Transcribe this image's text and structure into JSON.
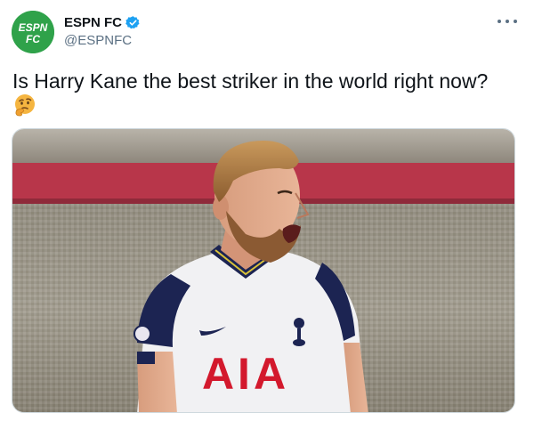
{
  "account": {
    "display_name": "ESPN FC",
    "handle": "@ESPNFC",
    "avatar_text_top": "ESPN",
    "avatar_text_bottom": "FC",
    "avatar_color": "#2fa24a",
    "verified": true,
    "verified_color": "#1da1f2"
  },
  "tweet": {
    "text": "Is Harry Kane the best striker in the world right now?",
    "emoji": "thinking-face-icon"
  },
  "media": {
    "shirt_sponsor": "AIA",
    "sponsor_color": "#d3192d"
  },
  "icons": {
    "more": "more-options-icon",
    "verified": "verified-badge-icon"
  }
}
